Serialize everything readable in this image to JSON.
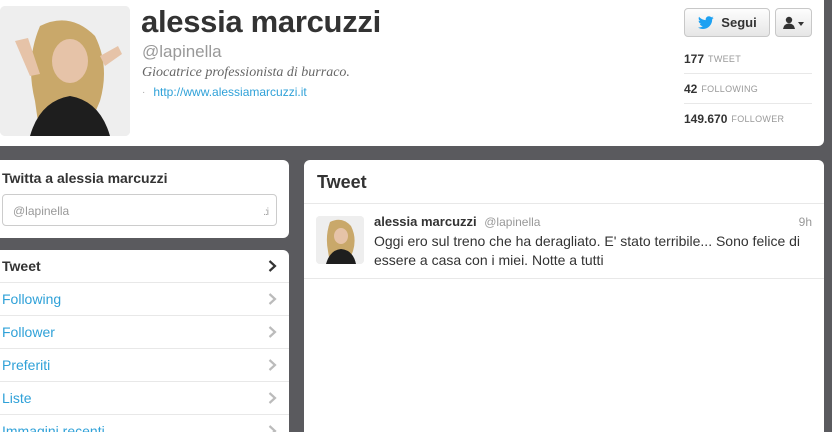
{
  "profile": {
    "name": "alessia marcuzzi",
    "handle": "@lapinella",
    "bio": "Giocatrice professionista di burraco.",
    "url": "http://www.alessiamarcuzzi.it",
    "follow_label": "Segui"
  },
  "stats": [
    {
      "value": "177",
      "label": "TWEET"
    },
    {
      "value": "42",
      "label": "FOLLOWING"
    },
    {
      "value": "149.670",
      "label": "FOLLOWER"
    }
  ],
  "tweet_to": {
    "title": "Twitta a alessia marcuzzi",
    "placeholder": "@lapinella"
  },
  "nav": {
    "items": [
      {
        "label": "Tweet"
      },
      {
        "label": "Following"
      },
      {
        "label": "Follower"
      },
      {
        "label": "Preferiti"
      },
      {
        "label": "Liste"
      },
      {
        "label": "Immagini recenti"
      }
    ]
  },
  "timeline": {
    "title": "Tweet",
    "tweets": [
      {
        "name": "alessia marcuzzi",
        "handle": "@lapinella",
        "time": "9h",
        "text": "Oggi ero sul treno che ha deragliato. E' stato terribile... Sono felice di essere a casa con i miei. Notte a tutti"
      }
    ]
  },
  "colors": {
    "background": "#5a5a5e",
    "link": "#2fa1d8",
    "text": "#333333",
    "muted": "#999999",
    "twitter_bird": "#1da1f2"
  },
  "icons": [
    "twitter-bird-icon",
    "user-icon",
    "caret-down-icon",
    "chevron-right-icon",
    "link-icon"
  ]
}
